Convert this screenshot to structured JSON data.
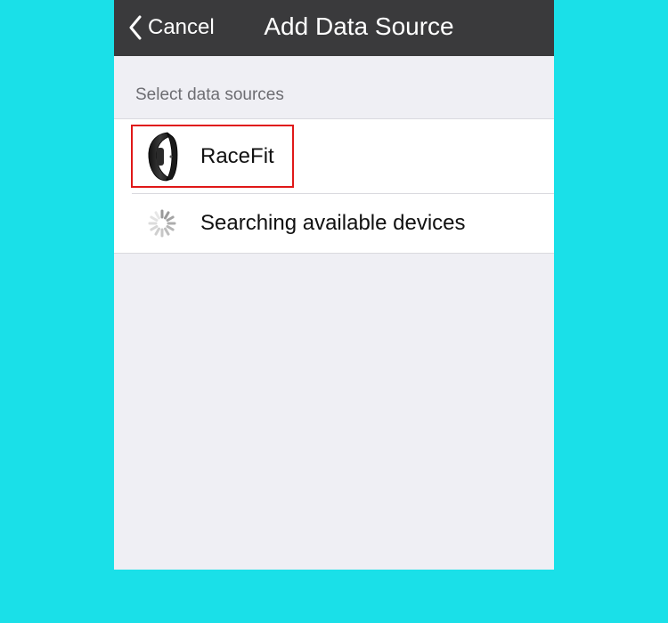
{
  "navbar": {
    "back_label": "Cancel",
    "title": "Add Data Source"
  },
  "section": {
    "header": "Select data sources"
  },
  "rows": [
    {
      "label": "RaceFit",
      "icon": "fitness-band-icon"
    },
    {
      "label": "Searching available devices",
      "icon": "spinner-icon"
    }
  ],
  "colors": {
    "background": "#1ae0e8",
    "navbar": "#3a3a3c",
    "highlight": "#e01818",
    "screen": "#efeff4"
  }
}
